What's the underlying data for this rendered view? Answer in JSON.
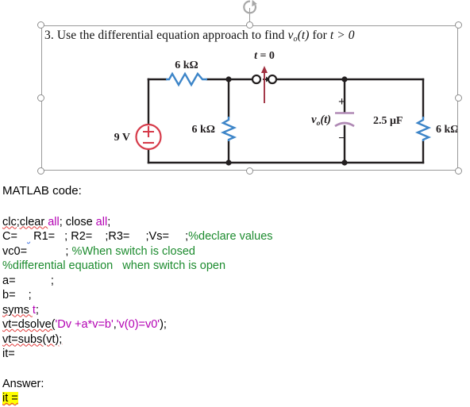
{
  "document": {
    "question": {
      "number": "3.",
      "text_before": "Use the differential equation approach to find",
      "symbol_main": "v",
      "symbol_sub": "o",
      "symbol_after": "(t)",
      "text_middle": "for",
      "condition": "t > 0",
      "full": "3. Use the differential equation approach to find v_o(t) for t > 0"
    },
    "matlab_heading": "MATLAB code:",
    "answer_heading": "Answer:",
    "answer_value": "it ="
  },
  "circuit": {
    "title": "RC circuit with switch",
    "source_label": "9 V",
    "source_plus": "+",
    "source_minus": "−",
    "switch_label": "t = 0",
    "resistor_top_label": "6 kΩ",
    "resistor_mid_label": "6 kΩ",
    "resistor_right_label": "6 kΩ",
    "capacitor_label": "2.5 μF",
    "cap_voltage_main": "v",
    "cap_voltage_sub": "o",
    "cap_voltage_after": "(t)",
    "cap_plus": "+",
    "cap_minus": "−",
    "colors": {
      "wire": "#231f20",
      "resistor": "#3d85c8",
      "source": "#d63b4a",
      "capacitor": "#b08ab5",
      "switch_arrow": "#a03040",
      "selection": "#9a9a9a"
    }
  },
  "code": {
    "lines": [
      {
        "id": "line-clc",
        "segments": [
          {
            "text": "clc;clear ",
            "cls": "sq-red"
          },
          {
            "text": "all",
            "cls": "kw"
          },
          {
            "text": "; close ",
            "cls": ""
          },
          {
            "text": "all",
            "cls": "kw"
          },
          {
            "text": ";",
            "cls": ""
          }
        ]
      },
      {
        "id": "line-values",
        "segments": [
          {
            "text": "C=   ",
            "cls": ""
          },
          {
            "text": " ",
            "cls": "sq-blue"
          },
          {
            "text": " R1=   ; R2=    ;R3=     ;Vs=     ;",
            "cls": ""
          },
          {
            "text": "%declare values",
            "cls": "cmt"
          }
        ]
      },
      {
        "id": "line-vc0",
        "segments": [
          {
            "text": "vc0=            ; ",
            "cls": ""
          },
          {
            "text": "%When switch is closed",
            "cls": "cmt"
          }
        ]
      },
      {
        "id": "line-diffeq",
        "segments": [
          {
            "text": "%differential equation   when switch is open",
            "cls": "cmt"
          }
        ]
      },
      {
        "id": "line-a",
        "segments": [
          {
            "text": "a=           ;",
            "cls": ""
          }
        ]
      },
      {
        "id": "line-b",
        "segments": [
          {
            "text": "b=    ;",
            "cls": ""
          }
        ]
      },
      {
        "id": "line-syms",
        "segments": [
          {
            "text": "syms ",
            "cls": "sq-red"
          },
          {
            "text": "t",
            "cls": "kw"
          },
          {
            "text": ";",
            "cls": ""
          }
        ]
      },
      {
        "id": "line-dsolve",
        "segments": [
          {
            "text": "vt=dsolve(",
            "cls": "sq-red"
          },
          {
            "text": "'Dv +a*v=b'",
            "cls": "str"
          },
          {
            "text": ",",
            "cls": ""
          },
          {
            "text": "'v(0)=v0'",
            "cls": "str"
          },
          {
            "text": ");",
            "cls": ""
          }
        ]
      },
      {
        "id": "line-subs",
        "segments": [
          {
            "text": "vt=subs(vt);",
            "cls": "sq-red"
          }
        ]
      },
      {
        "id": "line-it",
        "segments": [
          {
            "text": "it=",
            "cls": ""
          }
        ]
      }
    ]
  }
}
